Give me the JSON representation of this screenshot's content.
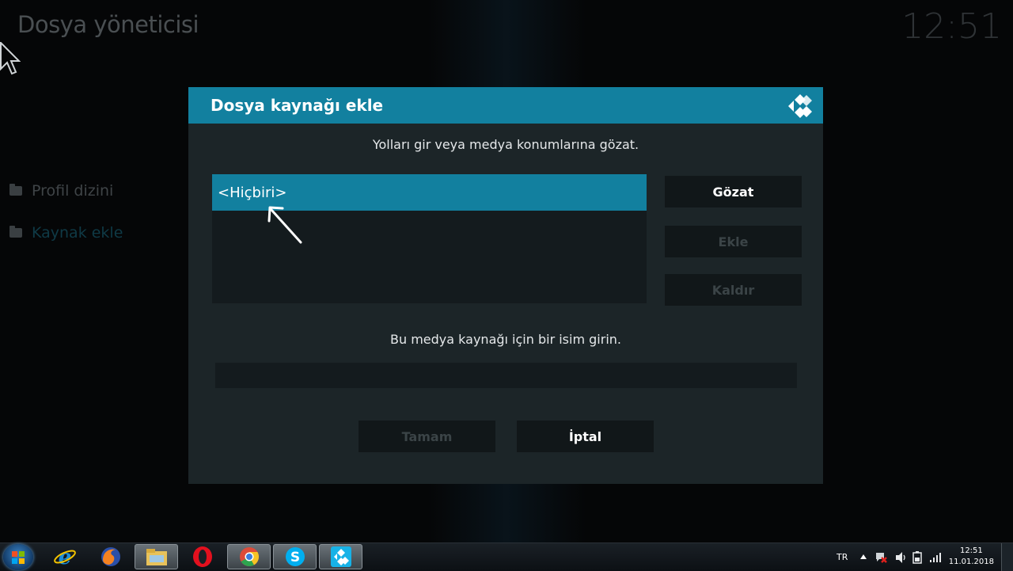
{
  "app": {
    "title": "Dosya yöneticisi",
    "clock": "12:51"
  },
  "sidebar": {
    "items": [
      {
        "label": "Profil dizini",
        "icon": "folder-icon",
        "active": false
      },
      {
        "label": "Kaynak ekle",
        "icon": "folder-icon",
        "active": true
      }
    ]
  },
  "dialog": {
    "title": "Dosya kaynağı ekle",
    "logo_icon": "kodi-logo-icon",
    "paths_instruction": "Yolları gir veya medya konumlarına gözat.",
    "paths": [
      "<Hiçbiri>"
    ],
    "buttons": {
      "browse": "Gözat",
      "add": "Ekle",
      "remove": "Kaldır"
    },
    "name_instruction": "Bu medya kaynağı için bir isim girin.",
    "name_value": "",
    "footer": {
      "ok": "Tamam",
      "cancel": "İptal"
    }
  },
  "taskbar": {
    "apps": [
      {
        "name": "internet-explorer-icon"
      },
      {
        "name": "firefox-icon"
      },
      {
        "name": "file-explorer-icon"
      },
      {
        "name": "opera-icon"
      },
      {
        "name": "chrome-icon"
      },
      {
        "name": "skype-icon"
      },
      {
        "name": "kodi-icon"
      }
    ],
    "language": "TR",
    "time": "12:51",
    "date": "11.01.2018"
  },
  "colors": {
    "accent": "#12809f",
    "dialog_bg": "#1c2528",
    "background": "#050607"
  }
}
